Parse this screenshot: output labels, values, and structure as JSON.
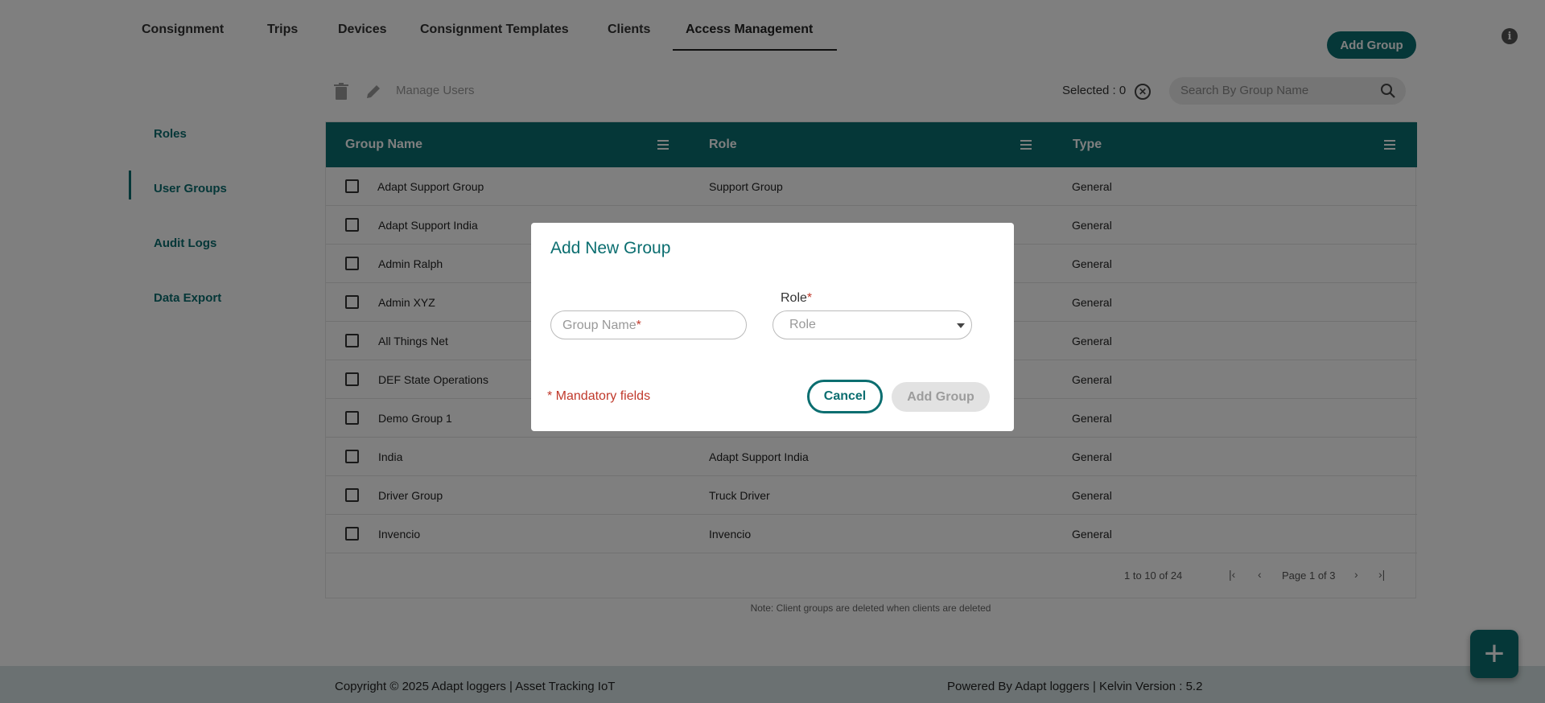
{
  "nav": {
    "tabs": [
      {
        "label": "Consignment"
      },
      {
        "label": "Trips"
      },
      {
        "label": "Devices"
      },
      {
        "label": "Consignment Templates"
      },
      {
        "label": "Clients"
      },
      {
        "label": "Access Management"
      }
    ],
    "active_tab": "Access Management",
    "add_group_label": "Add Group",
    "info_icon": "info-icon"
  },
  "sidebar": {
    "items": [
      {
        "label": "Roles"
      },
      {
        "label": "User Groups"
      },
      {
        "label": "Audit Logs"
      },
      {
        "label": "Data Export"
      }
    ],
    "active_item": "User Groups"
  },
  "toolbar": {
    "delete_icon": "trash-icon",
    "edit_icon": "pencil-icon",
    "manage_users_label": "Manage Users",
    "selected_text": "Selected : 0",
    "search_placeholder": "Search By Group Name"
  },
  "table": {
    "columns": [
      {
        "label": "Group Name"
      },
      {
        "label": "Role"
      },
      {
        "label": "Type"
      }
    ],
    "rows": [
      {
        "group": "Adapt Support Group",
        "role": "Support Group",
        "type": "General"
      },
      {
        "group": "Adapt Support India",
        "role": "",
        "type": "General"
      },
      {
        "group": "Admin Ralph",
        "role": "",
        "type": "General"
      },
      {
        "group": "Admin XYZ",
        "role": "",
        "type": "General"
      },
      {
        "group": "All Things Net",
        "role": "",
        "type": "General"
      },
      {
        "group": "DEF State Operations",
        "role": "",
        "type": "General"
      },
      {
        "group": "Demo Group 1",
        "role": "",
        "type": "General"
      },
      {
        "group": "India",
        "role": "Adapt Support India",
        "type": "General"
      },
      {
        "group": "Driver Group",
        "role": "Truck Driver",
        "type": "General"
      },
      {
        "group": "Invencio",
        "role": "Invencio",
        "type": "General"
      }
    ],
    "range_text": "1 to 10 of 24",
    "page_text": "Page 1 of 3",
    "note": "Note: Client groups are deleted when clients are deleted"
  },
  "footer": {
    "copyright": "Copyright © 2025 Adapt loggers | Asset Tracking IoT",
    "powered_by": "Powered By Adapt loggers | Kelvin Version : 5.2"
  },
  "modal": {
    "title": "Add New Group",
    "group_name_placeholder": "Group Name",
    "role_label": "Role",
    "role_placeholder": "Role",
    "required_mark": "*",
    "mandatory_text": "* Mandatory fields",
    "cancel_label": "Cancel",
    "add_label": "Add Group"
  },
  "colors": {
    "accent": "#0b6e70",
    "required": "#c0392b"
  }
}
